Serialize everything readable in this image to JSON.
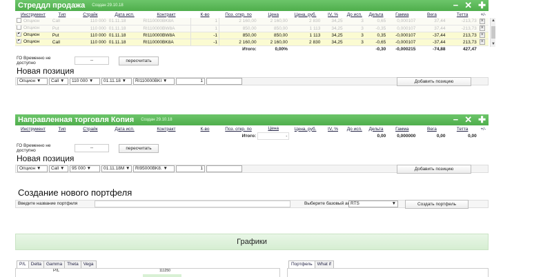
{
  "panel1": {
    "title": "Стреддл продажа",
    "created": "Создан 29.10.18",
    "controls": [
      "−",
      "✕",
      "✚"
    ],
    "columns": [
      "Инструмент",
      "Тип",
      "Страйк",
      "Дата исп.",
      "Контракт",
      "К-во",
      "Поз. откр. по",
      "Цена",
      "Цена, руб.",
      "IV, %",
      "До исп.",
      "Дельта",
      "Гамма",
      "Вега",
      "Тетта",
      "+/-"
    ],
    "rows": [
      {
        "state": "faded",
        "checked": false,
        "cells": [
          "Опцион",
          "Call",
          "110 000",
          "01.11.18",
          "RI110000BK8A",
          "1",
          "2 160,00",
          "2 160,00",
          "2 830",
          "34,25",
          "3",
          "0,65",
          "0,000107",
          "37,44",
          "-213,73"
        ]
      },
      {
        "state": "faded",
        "checked": false,
        "cells": [
          "Опцион",
          "Put",
          "110 000",
          "01.11.18",
          "RI110000BW8A",
          "1",
          "850,00",
          "850,00",
          "1 113",
          "34,25",
          "3",
          "-0,35",
          "0,000107",
          "37,44",
          "-213,73"
        ]
      },
      {
        "state": "active",
        "checked": true,
        "cells": [
          "Опцион",
          "Put",
          "110 000",
          "01.11.18",
          "RI110000BW8A",
          "-1",
          "850,00",
          "850,00",
          "1 113",
          "34,25",
          "3",
          "0,35",
          "-0,000107",
          "-37,44",
          "213,73"
        ]
      },
      {
        "state": "active",
        "checked": true,
        "cells": [
          "Опцион",
          "Call",
          "110 000",
          "01.11.18",
          "RI110000BK8A",
          "-1",
          "2 160,00",
          "2 160,00",
          "2 830",
          "34,25",
          "3",
          "-0,65",
          "-0,000107",
          "-37,44",
          "213,73"
        ]
      }
    ],
    "total_label": "Итого:",
    "total_pct": "0,00%",
    "total_delta": "-0,30",
    "total_gamma": "-0,000215",
    "total_vega": "-74,88",
    "total_theta": "427,47",
    "go_text": "ГО Временно не доступно",
    "go_value": "--",
    "recalc": "пересчитать",
    "new_pos_title": "Новая позиция",
    "new_row": {
      "instrument": "Опцион ▼",
      "type": "Call ▼",
      "strike": "110 000 ▼",
      "date": "01.11.18 ▼",
      "contract": "RI110000BKI ▼",
      "qty": "1"
    },
    "add_btn": "Добавить позицию"
  },
  "panel2": {
    "title": "Направленная торговля Копия",
    "created": "Создан 29.10.18",
    "controls": [
      "−",
      "✕",
      "✚"
    ],
    "total_label": "Итого:",
    "total_price": "-",
    "total_delta": "0,00",
    "total_gamma": "0,000000",
    "total_vega": "0,00",
    "total_theta": "0,00",
    "go_text": "ГО Временно не доступно",
    "go_value": "--",
    "recalc": "пересчитать",
    "new_pos_title": "Новая позиция",
    "new_row": {
      "instrument": "Опцион ▼",
      "type": "Call ▼",
      "strike": "95 000 ▼",
      "date": "01.11.18M ▼",
      "contract": "RI95000BK8. ▼",
      "qty": "1"
    },
    "add_btn": "Добавить позицию"
  },
  "new_portfolio": {
    "title": "Создание нового портфеля",
    "name_label": "Введите название портфеля",
    "asset_label": "Выберите базовый актив",
    "asset_value": "RTS",
    "create_btn": "Создать портфель"
  },
  "graphs": {
    "title": "Графики",
    "tabs": [
      "P/L",
      "Delta",
      "Gamma",
      "Theta",
      "Vega"
    ],
    "right_tabs": [
      "Портфель",
      "What if"
    ],
    "chart_label": "P/L",
    "chart_value": "111250"
  }
}
